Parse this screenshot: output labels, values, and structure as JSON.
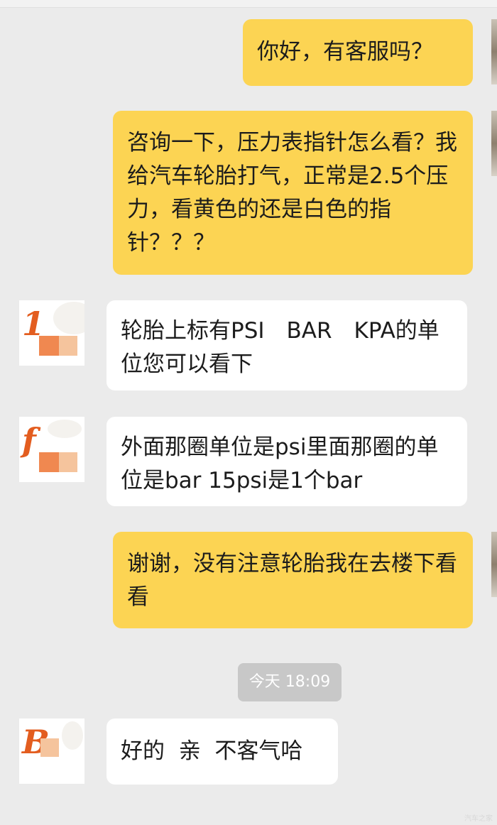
{
  "messages": [
    {
      "id": "m1",
      "side": "out",
      "text": "你好，有客服吗？"
    },
    {
      "id": "m2",
      "side": "out",
      "text": "咨询一下，压力表指针怎么看？我给汽车轮胎打气，正常是2.5个压力，看黄色的还是白色的指针？？？"
    },
    {
      "id": "m3",
      "side": "in",
      "text": "轮胎上标有PSI　BAR　KPA的单位您可以看下"
    },
    {
      "id": "m4",
      "side": "in",
      "text": "外面那圈单位是psi里面那圈的单位是bar 15psi是1个bar"
    },
    {
      "id": "m5",
      "side": "out",
      "text": "谢谢，没有注意轮胎我在去楼下看看"
    },
    {
      "id": "m6",
      "side": "in",
      "text": "好的  亲  不客气哈"
    }
  ],
  "timestamp": "今天 18:09",
  "agent_avatar_letters": [
    "1",
    "f",
    "B"
  ],
  "watermark": "汽车之家",
  "colors": {
    "outgoing_bubble": "#fcd453",
    "incoming_bubble": "#ffffff",
    "background": "#ebebeb",
    "timestamp_badge": "#c8c8c8"
  }
}
